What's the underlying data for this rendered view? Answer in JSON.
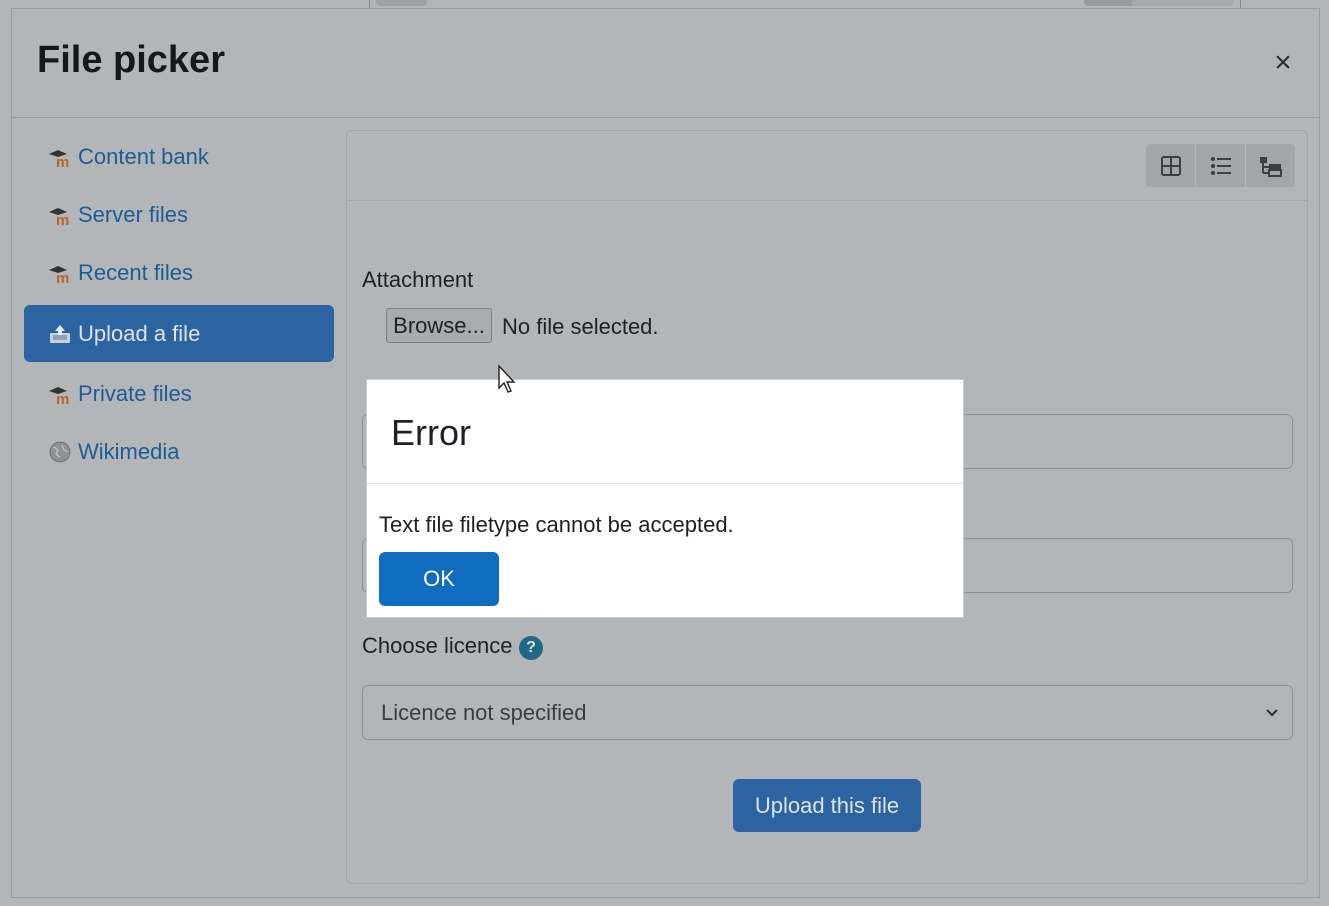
{
  "dialog": {
    "title": "File picker",
    "close_label": "×"
  },
  "sidebar": {
    "items": [
      {
        "label": "Content bank",
        "icon": "moodle-icon"
      },
      {
        "label": "Server files",
        "icon": "moodle-icon"
      },
      {
        "label": "Recent files",
        "icon": "moodle-icon"
      },
      {
        "label": "Upload a file",
        "icon": "upload-icon",
        "active": true
      },
      {
        "label": "Private files",
        "icon": "moodle-icon"
      },
      {
        "label": "Wikimedia",
        "icon": "wikimedia-icon"
      }
    ]
  },
  "toolbar": {
    "view_buttons": [
      "grid-view-icon",
      "list-view-icon",
      "tree-view-icon"
    ]
  },
  "form": {
    "attachment_label": "Attachment",
    "browse_label": "Browse...",
    "no_file_text": "No file selected.",
    "licence_label": "Choose licence",
    "licence_help": "?",
    "licence_value": "Licence not specified",
    "upload_label": "Upload this file"
  },
  "modal": {
    "title": "Error",
    "message": "Text file filetype cannot be accepted.",
    "ok_label": "OK"
  },
  "colors": {
    "accent": "#0f6cbf",
    "active_item": "#2b64a0",
    "overlay": "#b3b6b9"
  }
}
